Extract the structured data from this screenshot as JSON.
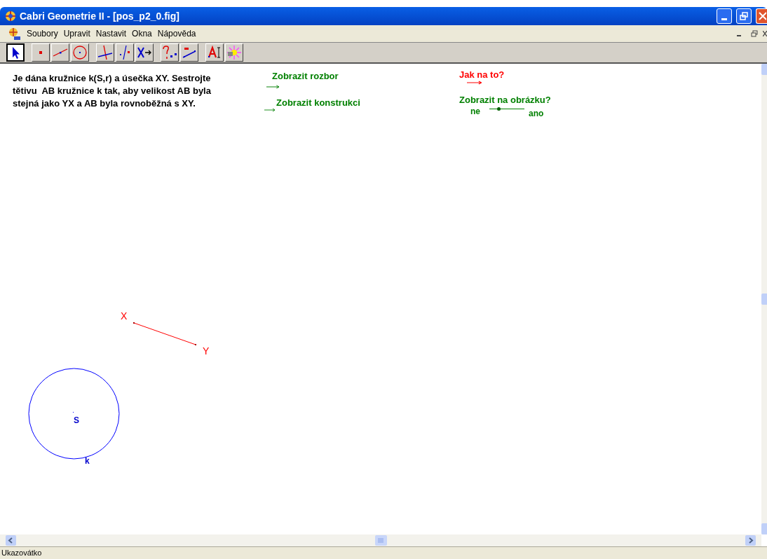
{
  "window": {
    "title": "Cabri Geometrie II - [pos_p2_0.fig]"
  },
  "menu": [
    "Soubory",
    "Upravit",
    "Nastavit",
    "Okna",
    "Nápověda"
  ],
  "toolbar": {
    "groups": [
      {
        "tools": [
          {
            "selected": true
          }
        ]
      },
      {
        "tools": [
          {
            "selected": false
          },
          {
            "selected": false
          },
          {
            "selected": false
          }
        ]
      },
      {
        "tools": [
          {
            "selected": false
          },
          {
            "selected": false
          },
          {
            "selected": false
          }
        ]
      },
      {
        "tools": [
          {
            "selected": false
          },
          {
            "selected": false
          }
        ]
      },
      {
        "tools": [
          {
            "selected": false
          },
          {
            "selected": false
          }
        ]
      }
    ]
  },
  "canvas": {
    "task": "Je dána kružnice k(S,r) a úsečka XY. Sestrojte\ntětivu  AB kružnice k tak, aby velikost AB byla\nstejná jako YX a AB byla rovnoběžná s XY.",
    "actions": [
      {
        "label": "Zobrazit rozbor",
        "color": "#008000"
      },
      {
        "label": "Zobrazit konstrukci",
        "color": "#008000"
      },
      {
        "label": "Jak na to?",
        "color": "#ff0000"
      }
    ],
    "toggle": {
      "label": "Zobrazit na obrázku?",
      "left": "ne",
      "right": "ano",
      "level": 0.25
    },
    "segment": {
      "start": "X",
      "end": "Y"
    },
    "circle": {
      "center": "S",
      "name": "k"
    }
  },
  "status_bar": "Ukazovátko"
}
